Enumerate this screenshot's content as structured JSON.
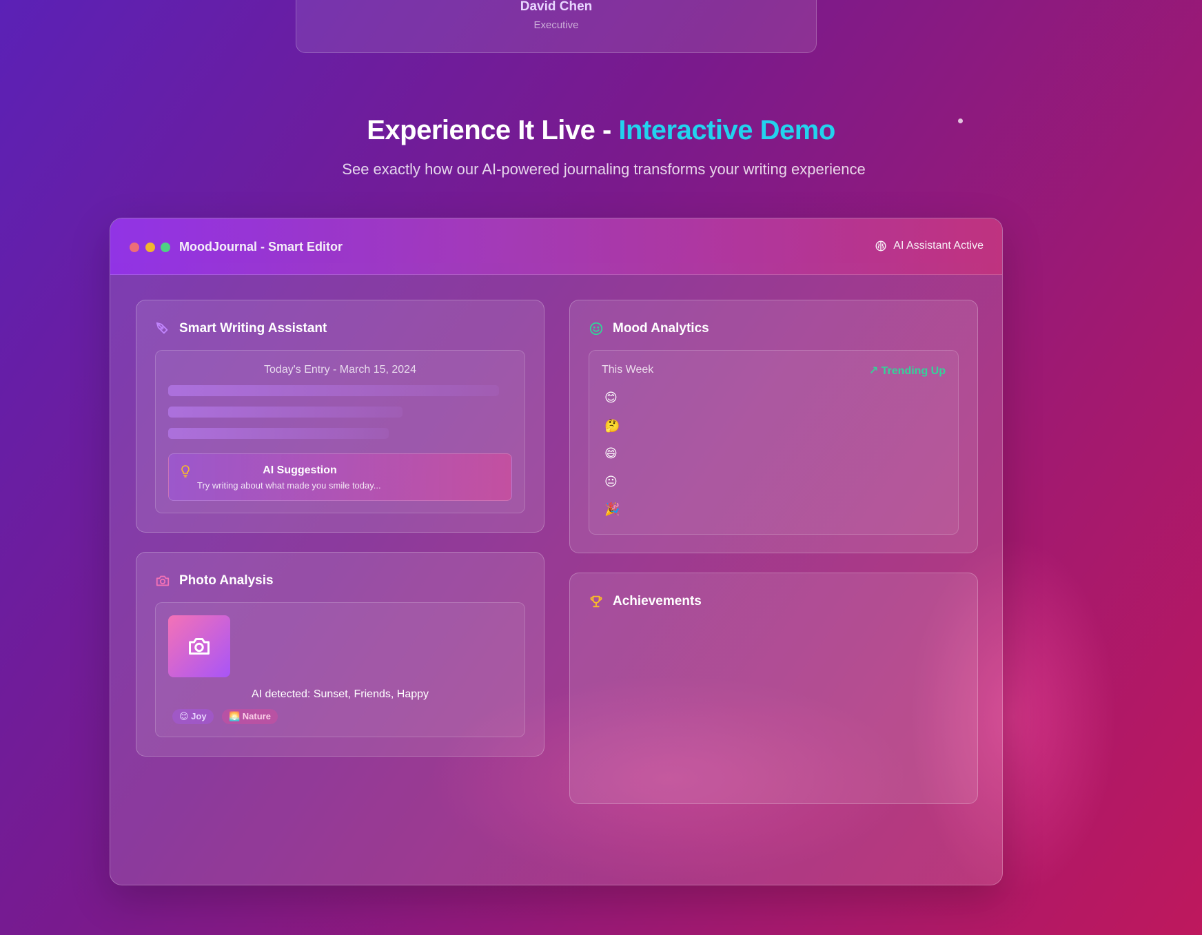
{
  "testimonial": {
    "name": "David Chen",
    "role": "Executive"
  },
  "hero": {
    "title_main": "Experience It Live - ",
    "title_accent": "Interactive Demo",
    "subtitle": "See exactly how our AI-powered journaling transforms your writing experience"
  },
  "window": {
    "title": "MoodJournal - Smart Editor",
    "ai_status": "AI Assistant Active"
  },
  "writing": {
    "title": "Smart Writing Assistant",
    "entry_date": "Today's Entry - March 15, 2024",
    "suggestion_title": "AI Suggestion",
    "suggestion_text": "Try writing about what made you smile today..."
  },
  "mood": {
    "title": "Mood Analytics",
    "period": "This Week",
    "trend": "↗ Trending Up",
    "emojis": [
      "😊",
      "🤔",
      "😄",
      "😐",
      "🎉"
    ]
  },
  "photo": {
    "title": "Photo Analysis",
    "detected": "AI detected: Sunset, Friends, Happy",
    "tags": [
      "😊 Joy",
      "🌅 Nature"
    ]
  },
  "achievements": {
    "title": "Achievements"
  },
  "colors": {
    "accent": "#22d3ee",
    "trend": "#34d399",
    "brand_purple": "#9333ea",
    "brand_pink": "#ec4899"
  }
}
